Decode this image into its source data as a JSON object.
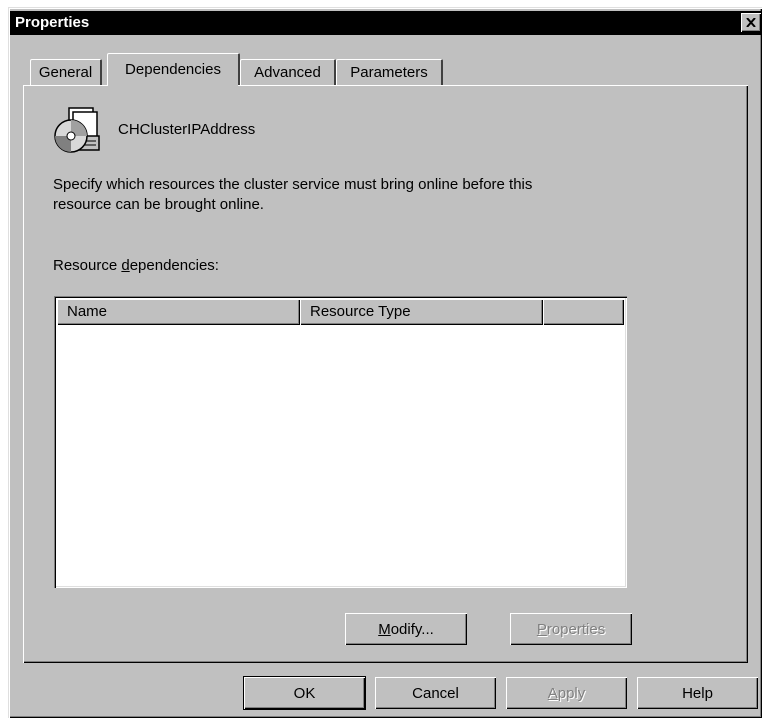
{
  "window": {
    "title": "Properties"
  },
  "tabs": [
    {
      "label": "General",
      "active": false
    },
    {
      "label": "Dependencies",
      "active": true
    },
    {
      "label": "Advanced",
      "active": false
    },
    {
      "label": "Parameters",
      "active": false
    }
  ],
  "resource": {
    "name": "CHClusterIPAddress",
    "icon": "cluster-resource-icon"
  },
  "description": {
    "line1": "Specify which resources the cluster service must bring online before this",
    "line2": "resource can be brought online."
  },
  "dependencies": {
    "label_pre": "Resource ",
    "label_mnemonic": "d",
    "label_post": "ependencies:",
    "columns": [
      "Name",
      "Resource Type",
      ""
    ],
    "rows": []
  },
  "panel_buttons": {
    "modify": {
      "mnemonic": "M",
      "rest": "odify...",
      "enabled": true
    },
    "properties": {
      "mnemonic": "P",
      "rest": "roperties",
      "enabled": false
    }
  },
  "dialog_buttons": {
    "ok": "OK",
    "cancel": "Cancel",
    "apply_mnemonic": "A",
    "apply_rest": "pply",
    "help": "Help"
  },
  "colors": {
    "face": "#c0c0c0",
    "titlebar": "#000000",
    "disabled_text": "#808080"
  }
}
